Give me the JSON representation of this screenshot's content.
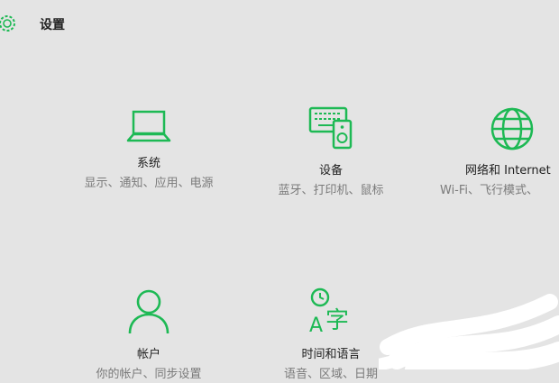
{
  "header": {
    "title": "设置",
    "icon": "gear-icon"
  },
  "accent_color": "#1db954",
  "tiles": [
    {
      "label": "系统",
      "desc": "显示、通知、应用、电源",
      "icon": "laptop-icon"
    },
    {
      "label": "设备",
      "desc": "蓝牙、打印机、鼠标",
      "icon": "devices-icon"
    },
    {
      "label": "网络和 Internet",
      "desc": "Wi-Fi、飞行模式、",
      "icon": "globe-icon"
    },
    {
      "label": "帐户",
      "desc": "你的帐户、同步设置",
      "icon": "person-icon"
    },
    {
      "label": "时间和语言",
      "desc": "语音、区域、日期",
      "icon": "time-language-icon"
    }
  ]
}
